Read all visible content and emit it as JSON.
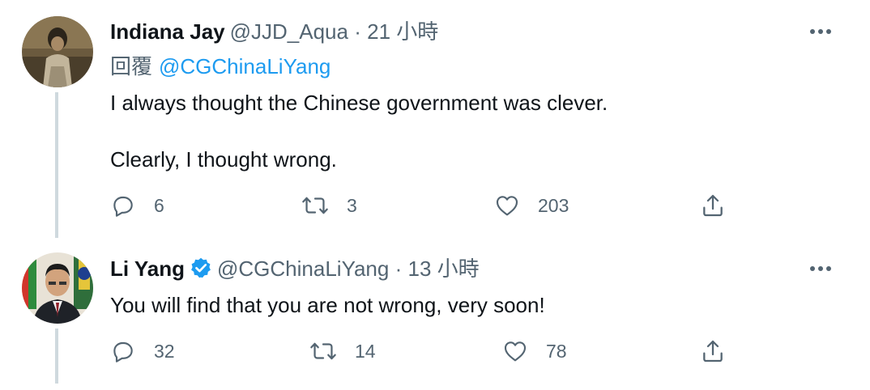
{
  "tweets": [
    {
      "display_name": "Indiana Jay",
      "handle": "@JJD_Aqua",
      "separator": "·",
      "time": "21 小時",
      "reply_label": "回覆",
      "reply_handle": "@CGChinaLiYang",
      "text_lines": [
        "I always thought the Chinese government was clever.",
        "Clearly, I thought wrong."
      ],
      "replies": "6",
      "retweets": "3",
      "likes": "203",
      "verified": false
    },
    {
      "display_name": "Li Yang",
      "handle": "@CGChinaLiYang",
      "separator": "·",
      "time": "13 小時",
      "text_lines": [
        "You will find that you are not wrong, very soon!"
      ],
      "replies": "32",
      "retweets": "14",
      "likes": "78",
      "verified": true
    }
  ],
  "icons": {
    "reply": "reply-icon",
    "retweet": "retweet-icon",
    "like": "heart-icon",
    "share": "share-icon",
    "more": "more-icon",
    "verified": "verified-badge-icon"
  },
  "colors": {
    "accent": "#1d9bf0",
    "secondary_text": "#536471",
    "primary_text": "#0f1419",
    "thread_line": "#cfd9de"
  }
}
